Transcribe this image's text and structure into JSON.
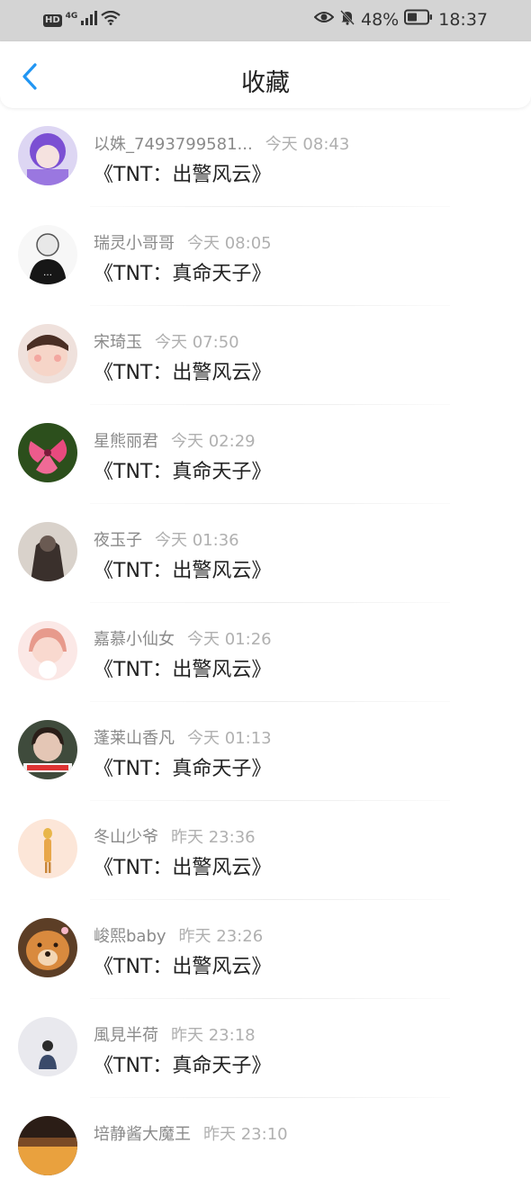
{
  "status_bar": {
    "hd": "HD",
    "network": "4G",
    "battery_pct": "48%",
    "time": "18:37"
  },
  "header": {
    "title": "收藏",
    "back_icon": "chevron-left-icon",
    "accent": "#2196F3"
  },
  "items": [
    {
      "name": "以姝_7493799581...",
      "time": "今天 08:43",
      "title": "《TNT：出警风云》",
      "avatar_colors": [
        "#b9a4e8",
        "#6b3fc9"
      ]
    },
    {
      "name": "瑞灵小哥哥",
      "time": "今天 08:05",
      "title": "《TNT：真命天子》",
      "avatar_colors": [
        "#f4f4f4",
        "#1a1a1a"
      ]
    },
    {
      "name": "宋琦玉",
      "time": "今天 07:50",
      "title": "《TNT：出警风云》",
      "avatar_colors": [
        "#f3d8cf",
        "#c98a75"
      ]
    },
    {
      "name": "星熊丽君",
      "time": "今天 02:29",
      "title": "《TNT：真命天子》",
      "avatar_colors": [
        "#2f5d1e",
        "#e8477a"
      ]
    },
    {
      "name": "夜玉子",
      "time": "今天 01:36",
      "title": "《TNT：出警风云》",
      "avatar_colors": [
        "#d8d2cc",
        "#3a3230"
      ]
    },
    {
      "name": "嘉慕小仙女",
      "time": "今天 01:26",
      "title": "《TNT：出警风云》",
      "avatar_colors": [
        "#fbe3e2",
        "#e89a93"
      ]
    },
    {
      "name": "蓬莱山香凡",
      "time": "今天 01:13",
      "title": "《TNT：真命天子》",
      "avatar_colors": [
        "#3c4a3a",
        "#e0c2b0"
      ]
    },
    {
      "name": "冬山少爷",
      "time": "昨天 23:36",
      "title": "《TNT：出警风云》",
      "avatar_colors": [
        "#fbe6d6",
        "#e7b64a"
      ]
    },
    {
      "name": "峻熙baby",
      "time": "昨天 23:26",
      "title": "《TNT：出警风云》",
      "avatar_colors": [
        "#6f4a2c",
        "#d8883c"
      ]
    },
    {
      "name": "風見半荷",
      "time": "昨天 23:18",
      "title": "《TNT：真命天子》",
      "avatar_colors": [
        "#e6e6ea",
        "#2a2a2a"
      ]
    },
    {
      "name": "培静酱大魔王",
      "time": "昨天 23:10",
      "title": "",
      "avatar_colors": [
        "#2b1d16",
        "#e9a13e"
      ]
    }
  ]
}
